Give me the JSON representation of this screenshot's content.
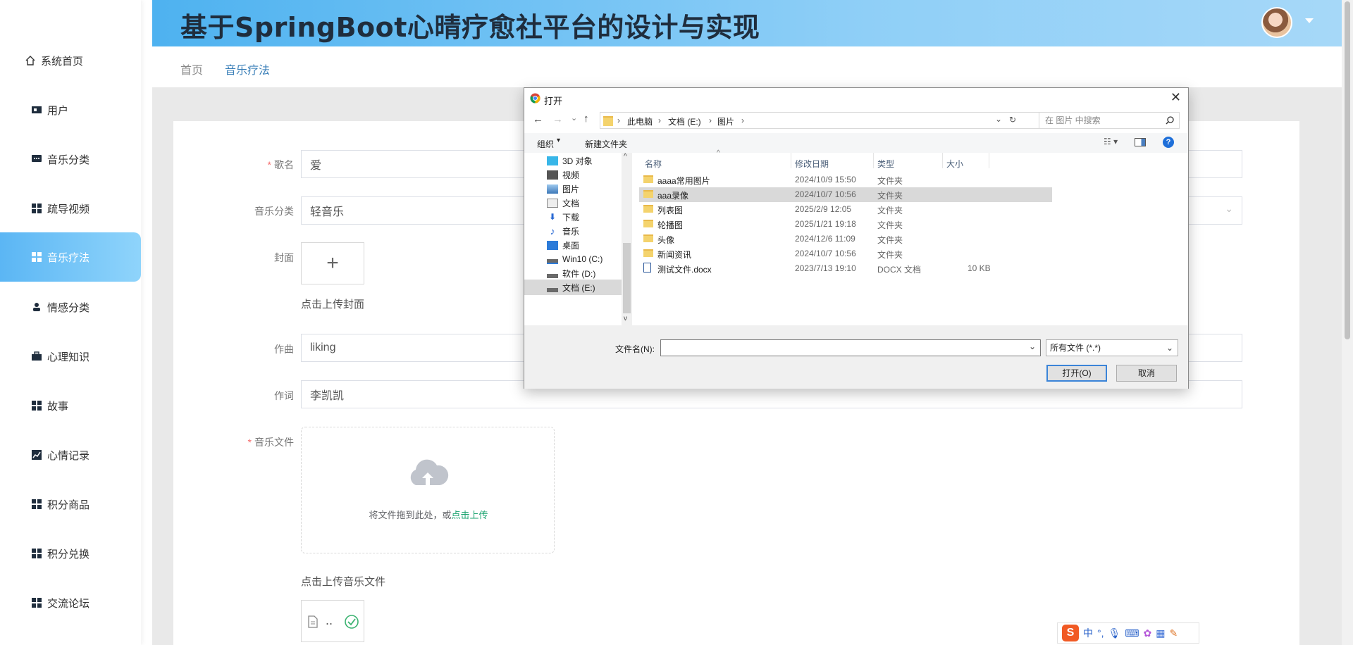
{
  "app": {
    "title": "基于SpringBoot心晴疗愈社平台的设计与实现"
  },
  "sidebar": {
    "items": [
      {
        "label": "系统首页",
        "icon": "home-icon"
      },
      {
        "label": "用户",
        "icon": "user-card-icon"
      },
      {
        "label": "音乐分类",
        "icon": "chat-icon"
      },
      {
        "label": "疏导视频",
        "icon": "grid-icon"
      },
      {
        "label": "音乐疗法",
        "icon": "grid-icon"
      },
      {
        "label": "情感分类",
        "icon": "person-icon"
      },
      {
        "label": "心理知识",
        "icon": "briefcase-icon"
      },
      {
        "label": "故事",
        "icon": "grid-icon"
      },
      {
        "label": "心情记录",
        "icon": "chart-icon"
      },
      {
        "label": "积分商品",
        "icon": "grid-icon"
      },
      {
        "label": "积分兑换",
        "icon": "grid-icon"
      },
      {
        "label": "交流论坛",
        "icon": "grid-icon"
      }
    ],
    "active_index": 4
  },
  "breadcrumb": {
    "home": "首页",
    "current": "音乐疗法"
  },
  "form": {
    "song_label": "歌名",
    "song_value": "爱",
    "category_label": "音乐分类",
    "category_value": "轻音乐",
    "cover_label": "封面",
    "cover_hint": "点击上传封面",
    "composer_label": "作曲",
    "composer_value": "liking",
    "lyricist_label": "作词",
    "lyricist_value": "李凯凯",
    "music_file_label": "音乐文件",
    "drag_text": "将文件拖到此处，或",
    "drag_link": "点击上传",
    "music_hint": "点击上传音乐文件",
    "file_thumb_text": ".."
  },
  "dialog": {
    "title": "打开",
    "path": [
      "此电脑",
      "文档 (E:)",
      "图片"
    ],
    "search_placeholder": "在 图片 中搜索",
    "organize": "组织",
    "new_folder": "新建文件夹",
    "tree": [
      "3D 对象",
      "视频",
      "图片",
      "文档",
      "下载",
      "音乐",
      "桌面",
      "Win10 (C:)",
      "软件 (D:)",
      "文档 (E:)"
    ],
    "columns": {
      "name": "名称",
      "modified": "修改日期",
      "type": "类型",
      "size": "大小"
    },
    "files": [
      {
        "name": "aaaa常用图片",
        "modified": "2024/10/9 15:50",
        "type": "文件夹",
        "size": ""
      },
      {
        "name": "aaa录像",
        "modified": "2024/10/7 10:56",
        "type": "文件夹",
        "size": ""
      },
      {
        "name": "列表图",
        "modified": "2025/2/9 12:05",
        "type": "文件夹",
        "size": ""
      },
      {
        "name": "轮播图",
        "modified": "2025/1/21 19:18",
        "type": "文件夹",
        "size": ""
      },
      {
        "name": "头像",
        "modified": "2024/12/6 11:09",
        "type": "文件夹",
        "size": ""
      },
      {
        "name": "新闻资讯",
        "modified": "2024/10/7 10:56",
        "type": "文件夹",
        "size": ""
      },
      {
        "name": "测试文件.docx",
        "modified": "2023/7/13 19:10",
        "type": "DOCX 文档",
        "size": "10 KB"
      }
    ],
    "filename_label": "文件名(N):",
    "filename_value": "",
    "filetype": "所有文件 (*.*)",
    "open_button": "打开(O)",
    "cancel_button": "取消"
  },
  "ime": {
    "mode": "中",
    "punct": "°,"
  }
}
